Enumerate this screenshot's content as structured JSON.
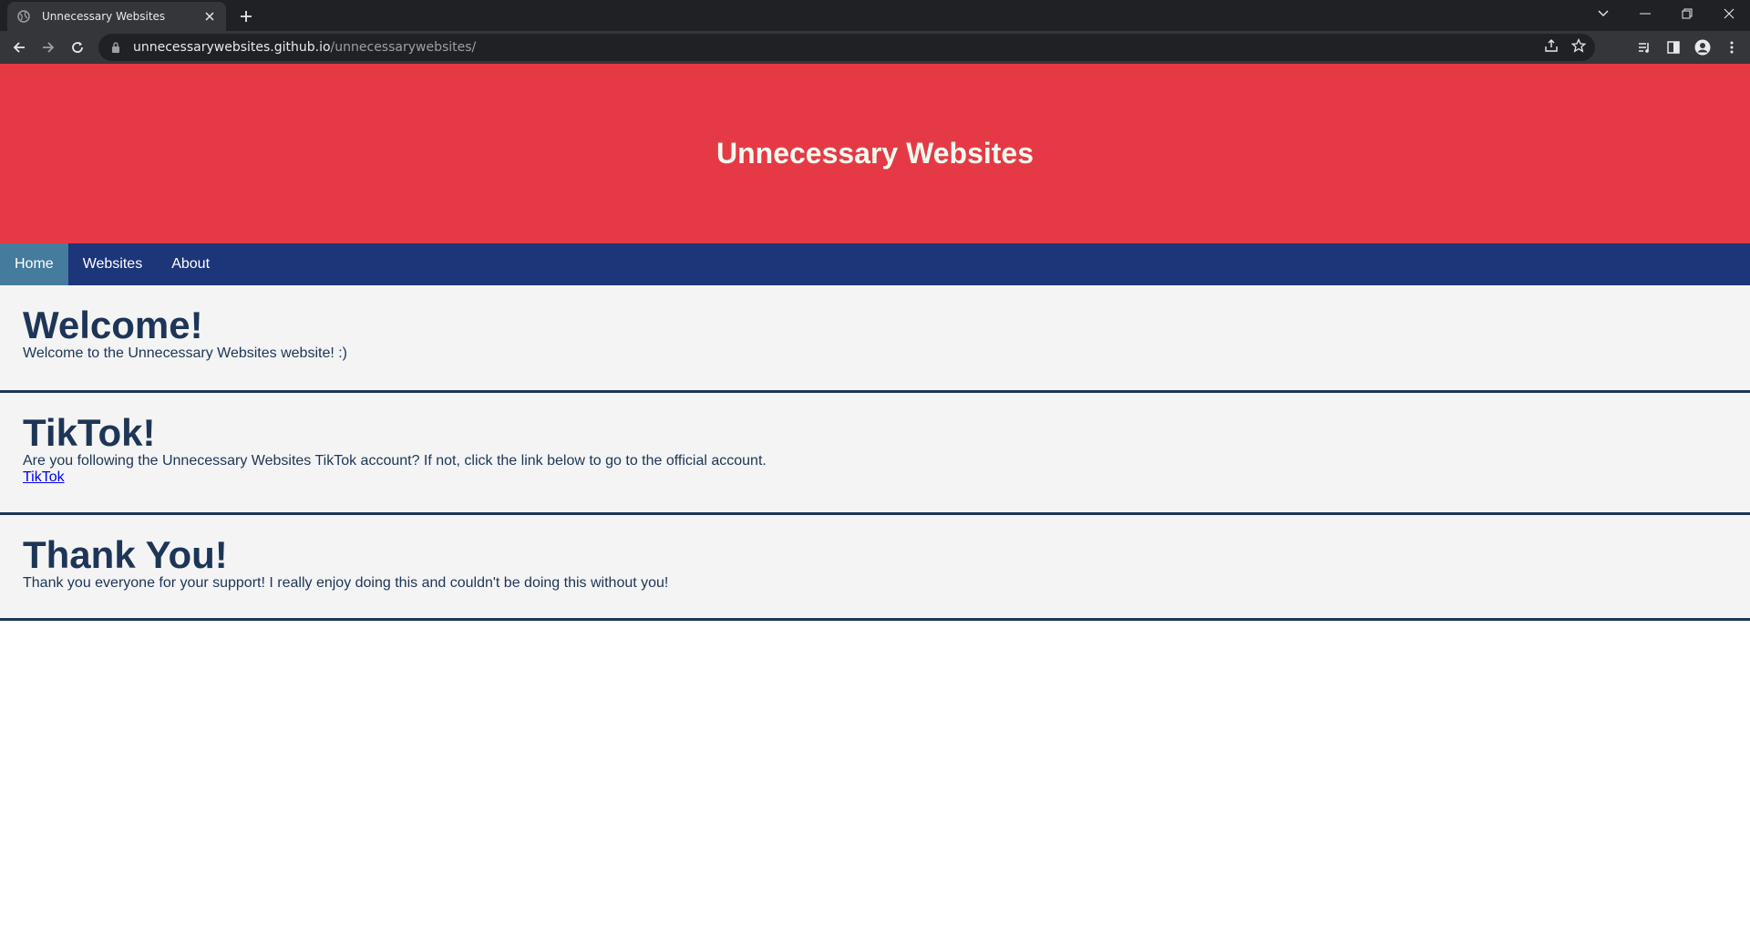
{
  "browser": {
    "tab_title": "Unnecessary Websites",
    "url_host": "unnecessarywebsites.github.io",
    "url_path": "/unnecessarywebsites/"
  },
  "site": {
    "title": "Unnecessary Websites",
    "colors": {
      "header": "#e63946",
      "nav": "#1d3579",
      "active_nav": "#457b9d",
      "text": "#1d3557"
    }
  },
  "nav": {
    "items": [
      {
        "label": "Home",
        "active": true
      },
      {
        "label": "Websites",
        "active": false
      },
      {
        "label": "About",
        "active": false
      }
    ]
  },
  "sections": [
    {
      "heading": "Welcome!",
      "text": "Welcome to the Unnecessary Websites website! :)"
    },
    {
      "heading": "TikTok!",
      "text": "Are you following the Unnecessary Websites TikTok account? If not, click the link below to go to the official account.",
      "link": "TikTok"
    },
    {
      "heading": "Thank You!",
      "text": "Thank you everyone for your support! I really enjoy doing this and couldn't be doing this without you!"
    }
  ]
}
